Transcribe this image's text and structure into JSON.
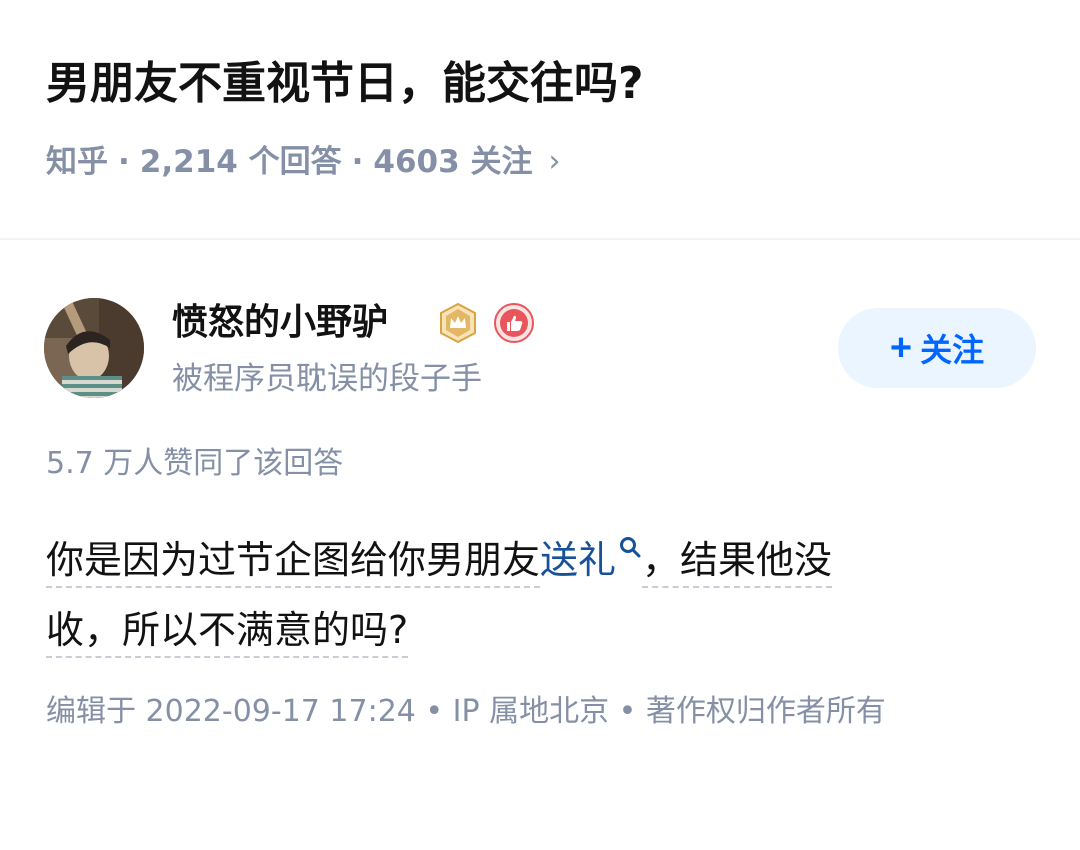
{
  "question": {
    "title": "男朋友不重视节日，能交往吗?",
    "source": "知乎",
    "separator": "·",
    "answers_count": "2,214 个回答",
    "followers_count": "4603 关注",
    "chevron": "›"
  },
  "author": {
    "name": "愤怒的小野驴",
    "bio": "被程序员耽误的段子手",
    "avatar_icon": "avatar-photo",
    "badges": [
      "crown-badge-icon",
      "thumbs-up-badge-icon"
    ],
    "follow_label": "关注",
    "follow_plus": "+"
  },
  "answer": {
    "votes": "5.7 万人赞同了该回答",
    "line1_part1": "你是因为过节企图给你男朋友",
    "keyword": "送礼",
    "line1_part2": "，结果他没",
    "line2": "收，所以不满意的吗?",
    "footer": "编辑于 2022-09-17 17:24 • IP 属地北京 • 著作权归作者所有"
  },
  "colors": {
    "accent": "#0066ff",
    "link": "#175199",
    "meta": "#8590a6",
    "badge_gold": "#d9a441",
    "badge_red": "#e8555b"
  }
}
